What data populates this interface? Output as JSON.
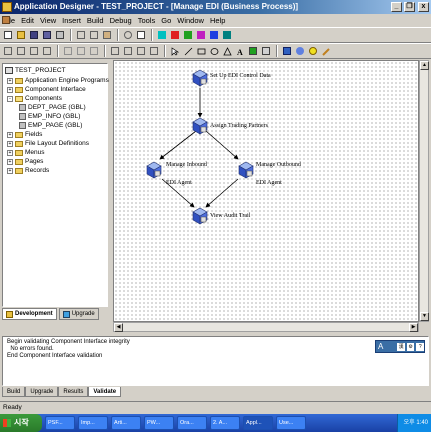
{
  "window": {
    "title": "Application Designer - TEST_PROJECT - [Manage EDI (Business Process)]",
    "minimize_glyph": "_",
    "restore_glyph": "❐",
    "close_glyph": "x"
  },
  "menu": [
    "File",
    "Edit",
    "View",
    "Insert",
    "Build",
    "Debug",
    "Tools",
    "Go",
    "Window",
    "Help"
  ],
  "colors": {
    "titlebar_start": "#0a246a",
    "canvas_grid": "#707070",
    "taskbar": "#3168d5"
  },
  "project_tree": {
    "root": "TEST_PROJECT",
    "items": [
      {
        "label": "Application Engine Programs",
        "toggle": "+",
        "level": 1
      },
      {
        "label": "Component Interface",
        "toggle": "+",
        "level": 1
      },
      {
        "label": "Components",
        "toggle": "-",
        "level": 1
      },
      {
        "label": "DEPT_PAGE (GBL)",
        "toggle": "",
        "level": 2
      },
      {
        "label": "EMP_INFO (GBL)",
        "toggle": "",
        "level": 2
      },
      {
        "label": "EMP_PAGE (GBL)",
        "toggle": "",
        "level": 2
      },
      {
        "label": "Fields",
        "toggle": "+",
        "level": 1
      },
      {
        "label": "File Layout Definitions",
        "toggle": "+",
        "level": 1
      },
      {
        "label": "Menus",
        "toggle": "+",
        "level": 1
      },
      {
        "label": "Pages",
        "toggle": "+",
        "level": 1
      },
      {
        "label": "Records",
        "toggle": "+",
        "level": 1
      }
    ],
    "tabs": [
      {
        "label": "Development",
        "active": true
      },
      {
        "label": "Upgrade",
        "active": false
      }
    ]
  },
  "business_process": {
    "steps": [
      {
        "label": "Set Up EDI Control Data"
      },
      {
        "label": "Assign Trading Partners"
      },
      {
        "label": "Manage Inbound",
        "label2": "EDI Agent"
      },
      {
        "label": "Manage Outbound",
        "label2": "EDI Agent"
      },
      {
        "label": "View Audit Trail"
      }
    ]
  },
  "output": {
    "lines": [
      "Begin validating Component Interface integrity",
      "  No errors found.",
      "End Component Interface validation"
    ],
    "tabs": [
      {
        "label": "Build",
        "active": false
      },
      {
        "label": "Upgrade",
        "active": false
      },
      {
        "label": "Results",
        "active": false
      },
      {
        "label": "Validate",
        "active": true
      }
    ],
    "ime_label": "A"
  },
  "status": {
    "text": "Ready"
  },
  "taskbar": {
    "start_label": "시작",
    "tasks": [
      "PSF...",
      "Imp...",
      "Arti...",
      "PW...",
      "Ora...",
      "2. A...",
      "Appl...",
      "Use..."
    ],
    "active_task": 6,
    "clock": "오후 1:40"
  }
}
